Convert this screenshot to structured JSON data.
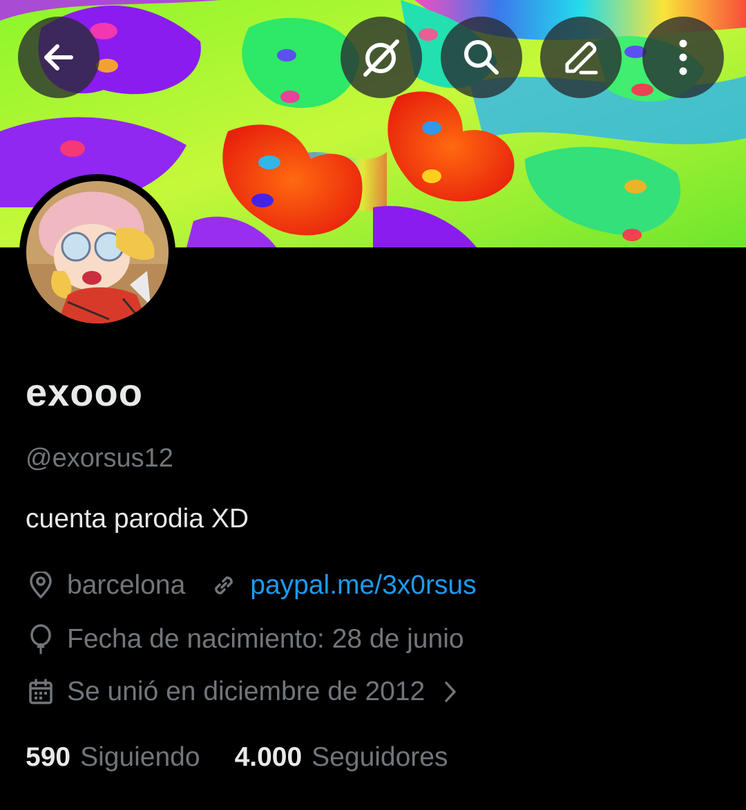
{
  "header": {
    "back_icon": "arrow-left-icon",
    "grok_icon": "grok-icon",
    "search_icon": "search-icon",
    "edit_icon": "edit-pencil-icon",
    "more_icon": "more-vertical-icon"
  },
  "banner": {
    "description_icon": "psychedelic-hearts-banner"
  },
  "profile": {
    "display_name": "exooo",
    "handle": "@exorsus12",
    "bio": "cuenta parodia XD",
    "location": "barcelona",
    "website": "paypal.me/3x0rsus",
    "birthday": "Fecha de nacimiento: 28 de junio",
    "joined": "Se unió en diciembre de 2012"
  },
  "stats": {
    "following_count": "590",
    "following_label": "Siguiendo",
    "followers_count": "4.000",
    "followers_label": "Seguidores"
  },
  "colors": {
    "background": "#000000",
    "primary_text": "#e7e9ea",
    "secondary_text": "#71767b",
    "link": "#1d9bf0"
  }
}
